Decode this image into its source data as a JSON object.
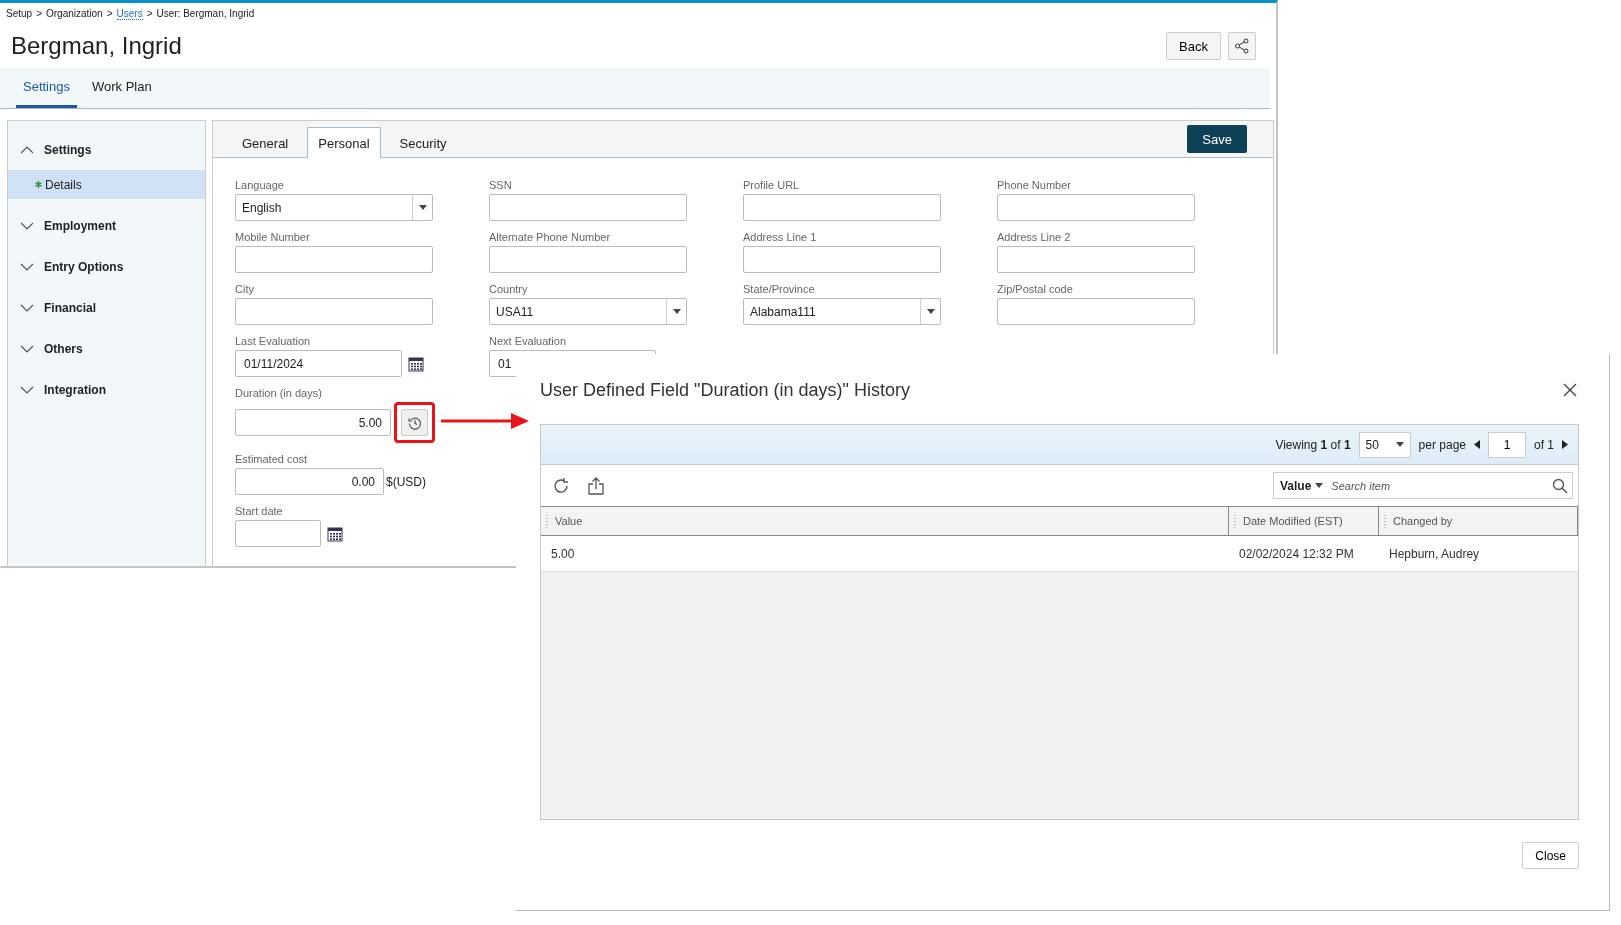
{
  "breadcrumb": {
    "separator": ">",
    "items": [
      {
        "label": "Setup",
        "link": false
      },
      {
        "label": "Organization",
        "link": false
      },
      {
        "label": "Users",
        "link": true
      },
      {
        "label": "User: Bergman, Ingrid",
        "link": false
      }
    ]
  },
  "title": "Bergman, Ingrid",
  "header_buttons": [
    {
      "kind": "text",
      "label": "Back"
    },
    {
      "kind": "share"
    }
  ],
  "main_tabs": [
    {
      "label": "Settings",
      "selected": true
    },
    {
      "label": "Work Plan",
      "selected": false
    }
  ],
  "sidebar": {
    "groups": [
      {
        "label": "Settings",
        "expanded": true,
        "items": [
          {
            "label": "Details",
            "selected": true,
            "required": true
          }
        ]
      },
      {
        "label": "Employment",
        "expanded": false
      },
      {
        "label": "Entry Options",
        "expanded": false
      },
      {
        "label": "Financial",
        "expanded": false
      },
      {
        "label": "Others",
        "expanded": false
      },
      {
        "label": "Integration",
        "expanded": false
      }
    ]
  },
  "form_tabs": [
    {
      "label": "General",
      "selected": false
    },
    {
      "label": "Personal",
      "selected": true
    },
    {
      "label": "Security",
      "selected": false
    }
  ],
  "save_button": "Save",
  "form_rows": [
    [
      {
        "kind": "select",
        "label": "Language",
        "value": "English"
      },
      {
        "kind": "text",
        "label": "SSN"
      },
      {
        "kind": "text",
        "label": "Profile URL"
      },
      {
        "kind": "text",
        "label": "Phone Number"
      }
    ],
    [
      {
        "kind": "text",
        "label": "Mobile Number"
      },
      {
        "kind": "text",
        "label": "Alternate Phone Number"
      },
      {
        "kind": "text",
        "label": "Address Line 1"
      },
      {
        "kind": "text",
        "label": "Address Line 2"
      }
    ],
    [
      {
        "kind": "text",
        "label": "City"
      },
      {
        "kind": "select",
        "label": "Country",
        "value": "USA11"
      },
      {
        "kind": "select",
        "label": "State/Province",
        "value": "Alabama111"
      },
      {
        "kind": "text",
        "label": "Zip/Postal code"
      }
    ],
    [
      {
        "kind": "date",
        "label": "Last Evaluation",
        "value": "01/11/2024"
      },
      {
        "kind": "date",
        "label": "Next Evaluation",
        "value": "01"
      }
    ],
    [
      {
        "kind": "history",
        "label": "Duration (in days)",
        "value": "5.00",
        "highlighted": true
      }
    ],
    [
      {
        "kind": "currency",
        "label": "Estimated cost",
        "value": "0.00",
        "unit": "$(USD)"
      }
    ],
    [
      {
        "kind": "date",
        "label": "Start date",
        "short": true
      }
    ]
  ],
  "dialog": {
    "title": "User Defined Field \"Duration (in days)\" History",
    "pager": {
      "viewing": "Viewing **1** of **1**",
      "page_size": "50",
      "per_page": "per page",
      "page": "1",
      "of_pages": "of 1"
    },
    "search": {
      "field": "Value",
      "placeholder": "Search item"
    },
    "columns": [
      "Value",
      "Date Modified (EST)",
      "Changed by"
    ],
    "rows": [
      [
        "5.00",
        "02/02/2024 12:32 PM",
        "Hepburn, Audrey"
      ]
    ],
    "close_button": "Close"
  }
}
